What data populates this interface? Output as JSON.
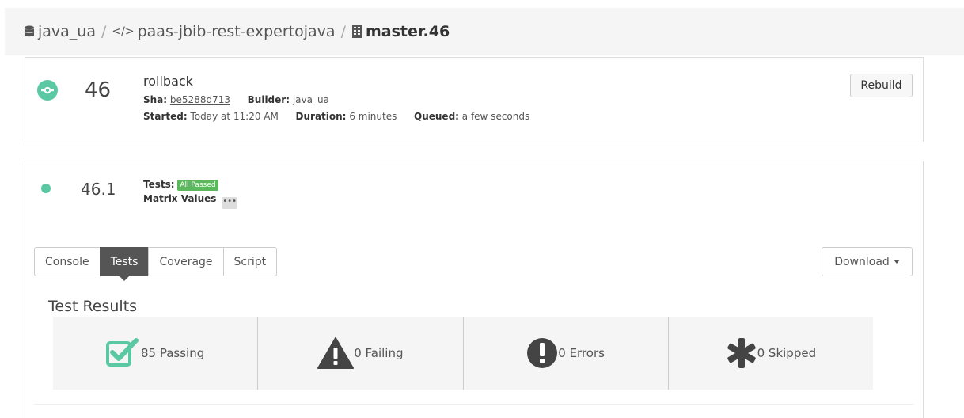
{
  "breadcrumb": {
    "owner": "java_ua",
    "separator": "/",
    "repo": "paas-jbib-rest-expertojava",
    "build": "master.46"
  },
  "build": {
    "number": "46",
    "message": "rollback",
    "sha_label": "Sha:",
    "sha": "be5288d713",
    "builder_label": "Builder:",
    "builder": "java_ua",
    "started_label": "Started:",
    "started": "Today at 11:20 AM",
    "duration_label": "Duration:",
    "duration": "6 minutes",
    "queued_label": "Queued:",
    "queued": "a few seconds",
    "rebuild_label": "Rebuild"
  },
  "run": {
    "number": "46.1",
    "tests_label": "Tests:",
    "tests_badge": "All Passed",
    "matrix_label": "Matrix Values",
    "matrix_toggle": "•••"
  },
  "tabs": [
    {
      "label": "Console"
    },
    {
      "label": "Tests",
      "active": true
    },
    {
      "label": "Coverage"
    },
    {
      "label": "Script"
    }
  ],
  "download_label": "Download",
  "results": {
    "title": "Test Results",
    "passing": "85 Passing",
    "failing": "0 Failing",
    "errors": "0 Errors",
    "skipped": "0 Skipped"
  },
  "colors": {
    "success": "#5ac8a2",
    "badge": "#5cb85c",
    "active_tab": "#555555"
  }
}
